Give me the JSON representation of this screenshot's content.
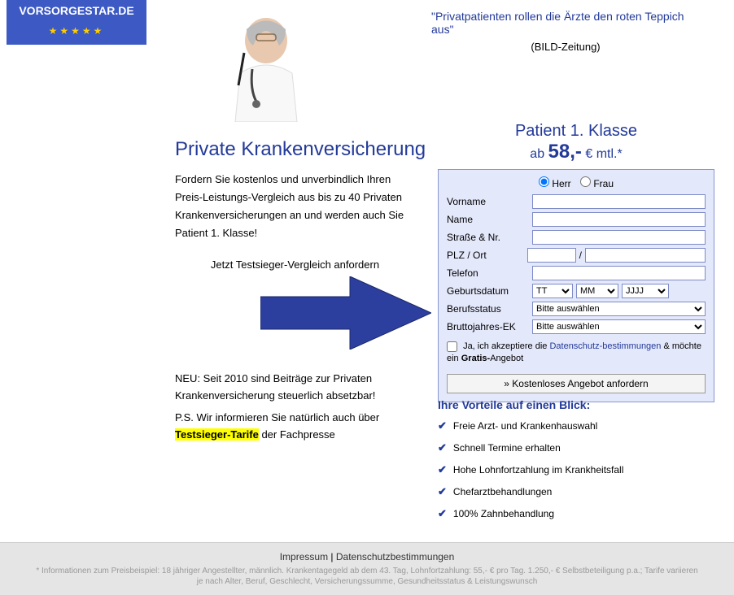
{
  "brand": "VORSORGESTAR.DE",
  "stars": "★★★★★",
  "quote": {
    "text": "\"Privatpatienten rollen die Ärzte den roten Teppich aus\"",
    "source": "(BILD-Zeitung)"
  },
  "heading": "Private Krankenversicherung",
  "intro": "Fordern Sie kostenlos und unverbindlich Ihren Preis-Leistungs-Vergleich aus bis zu 40 Privaten Krankenversicherungen an und werden auch Sie Patient 1. Klasse!",
  "cta": "Jetzt Testsieger-Vergleich anfordern",
  "neu": "NEU: Seit 2010 sind Beiträge zur Privaten Krankenversicherung steuerlich absetzbar!",
  "ps_pre": "P.S. Wir informieren Sie natürlich auch über ",
  "ps_highlight": "Testsieger-Tarife",
  "ps_post": " der Fachpresse",
  "offer": {
    "line1": "Patient 1. Klasse",
    "line2_pre": "ab ",
    "price": "58,-",
    "line2_post": " € mtl.*"
  },
  "form": {
    "gender_m": "Herr",
    "gender_f": "Frau",
    "labels": {
      "vorname": "Vorname",
      "name": "Name",
      "strasse": "Straße & Nr.",
      "plz": "PLZ / Ort",
      "telefon": "Telefon",
      "dob": "Geburtsdatum",
      "status": "Berufsstatus",
      "income": "Bruttojahres-EK"
    },
    "dob": {
      "tt": "TT",
      "mm": "MM",
      "jjjj": "JJJJ"
    },
    "select_placeholder": "Bitte auswählen",
    "slash": "/",
    "consent_pre": "Ja, ich akzeptiere die ",
    "consent_link": "Datenschutz-bestimmungen",
    "consent_post": " & möchte ein ",
    "consent_bold": "Gratis-",
    "consent_end": "Angebot",
    "submit": "» Kostenloses Angebot anfordern"
  },
  "benefits": {
    "title": "Ihre Vorteile auf einen Blick:",
    "items": [
      "Freie Arzt- und Krankenhauswahl",
      "Schnell Termine erhalten",
      "Hohe Lohnfortzahlung im Krankheitsfall",
      "Chefarztbehandlungen",
      "100% Zahnbehandlung"
    ]
  },
  "footer": {
    "imprint": "Impressum",
    "sep": " | ",
    "privacy": "Datenschutzbestimmungen",
    "disclaimer": "* Informationen zum Preisbeispiel: 18 jähriger Angestellter, männlich. Krankentagegeld ab dem 43. Tag, Lohnfortzahlung: 55,- € pro Tag. 1.250,- € Selbstbeteiligung p.a.; Tarife variieren je nach Alter, Beruf, Geschlecht, Versicherungssumme, Gesundheitsstatus & Leistungswunsch"
  }
}
